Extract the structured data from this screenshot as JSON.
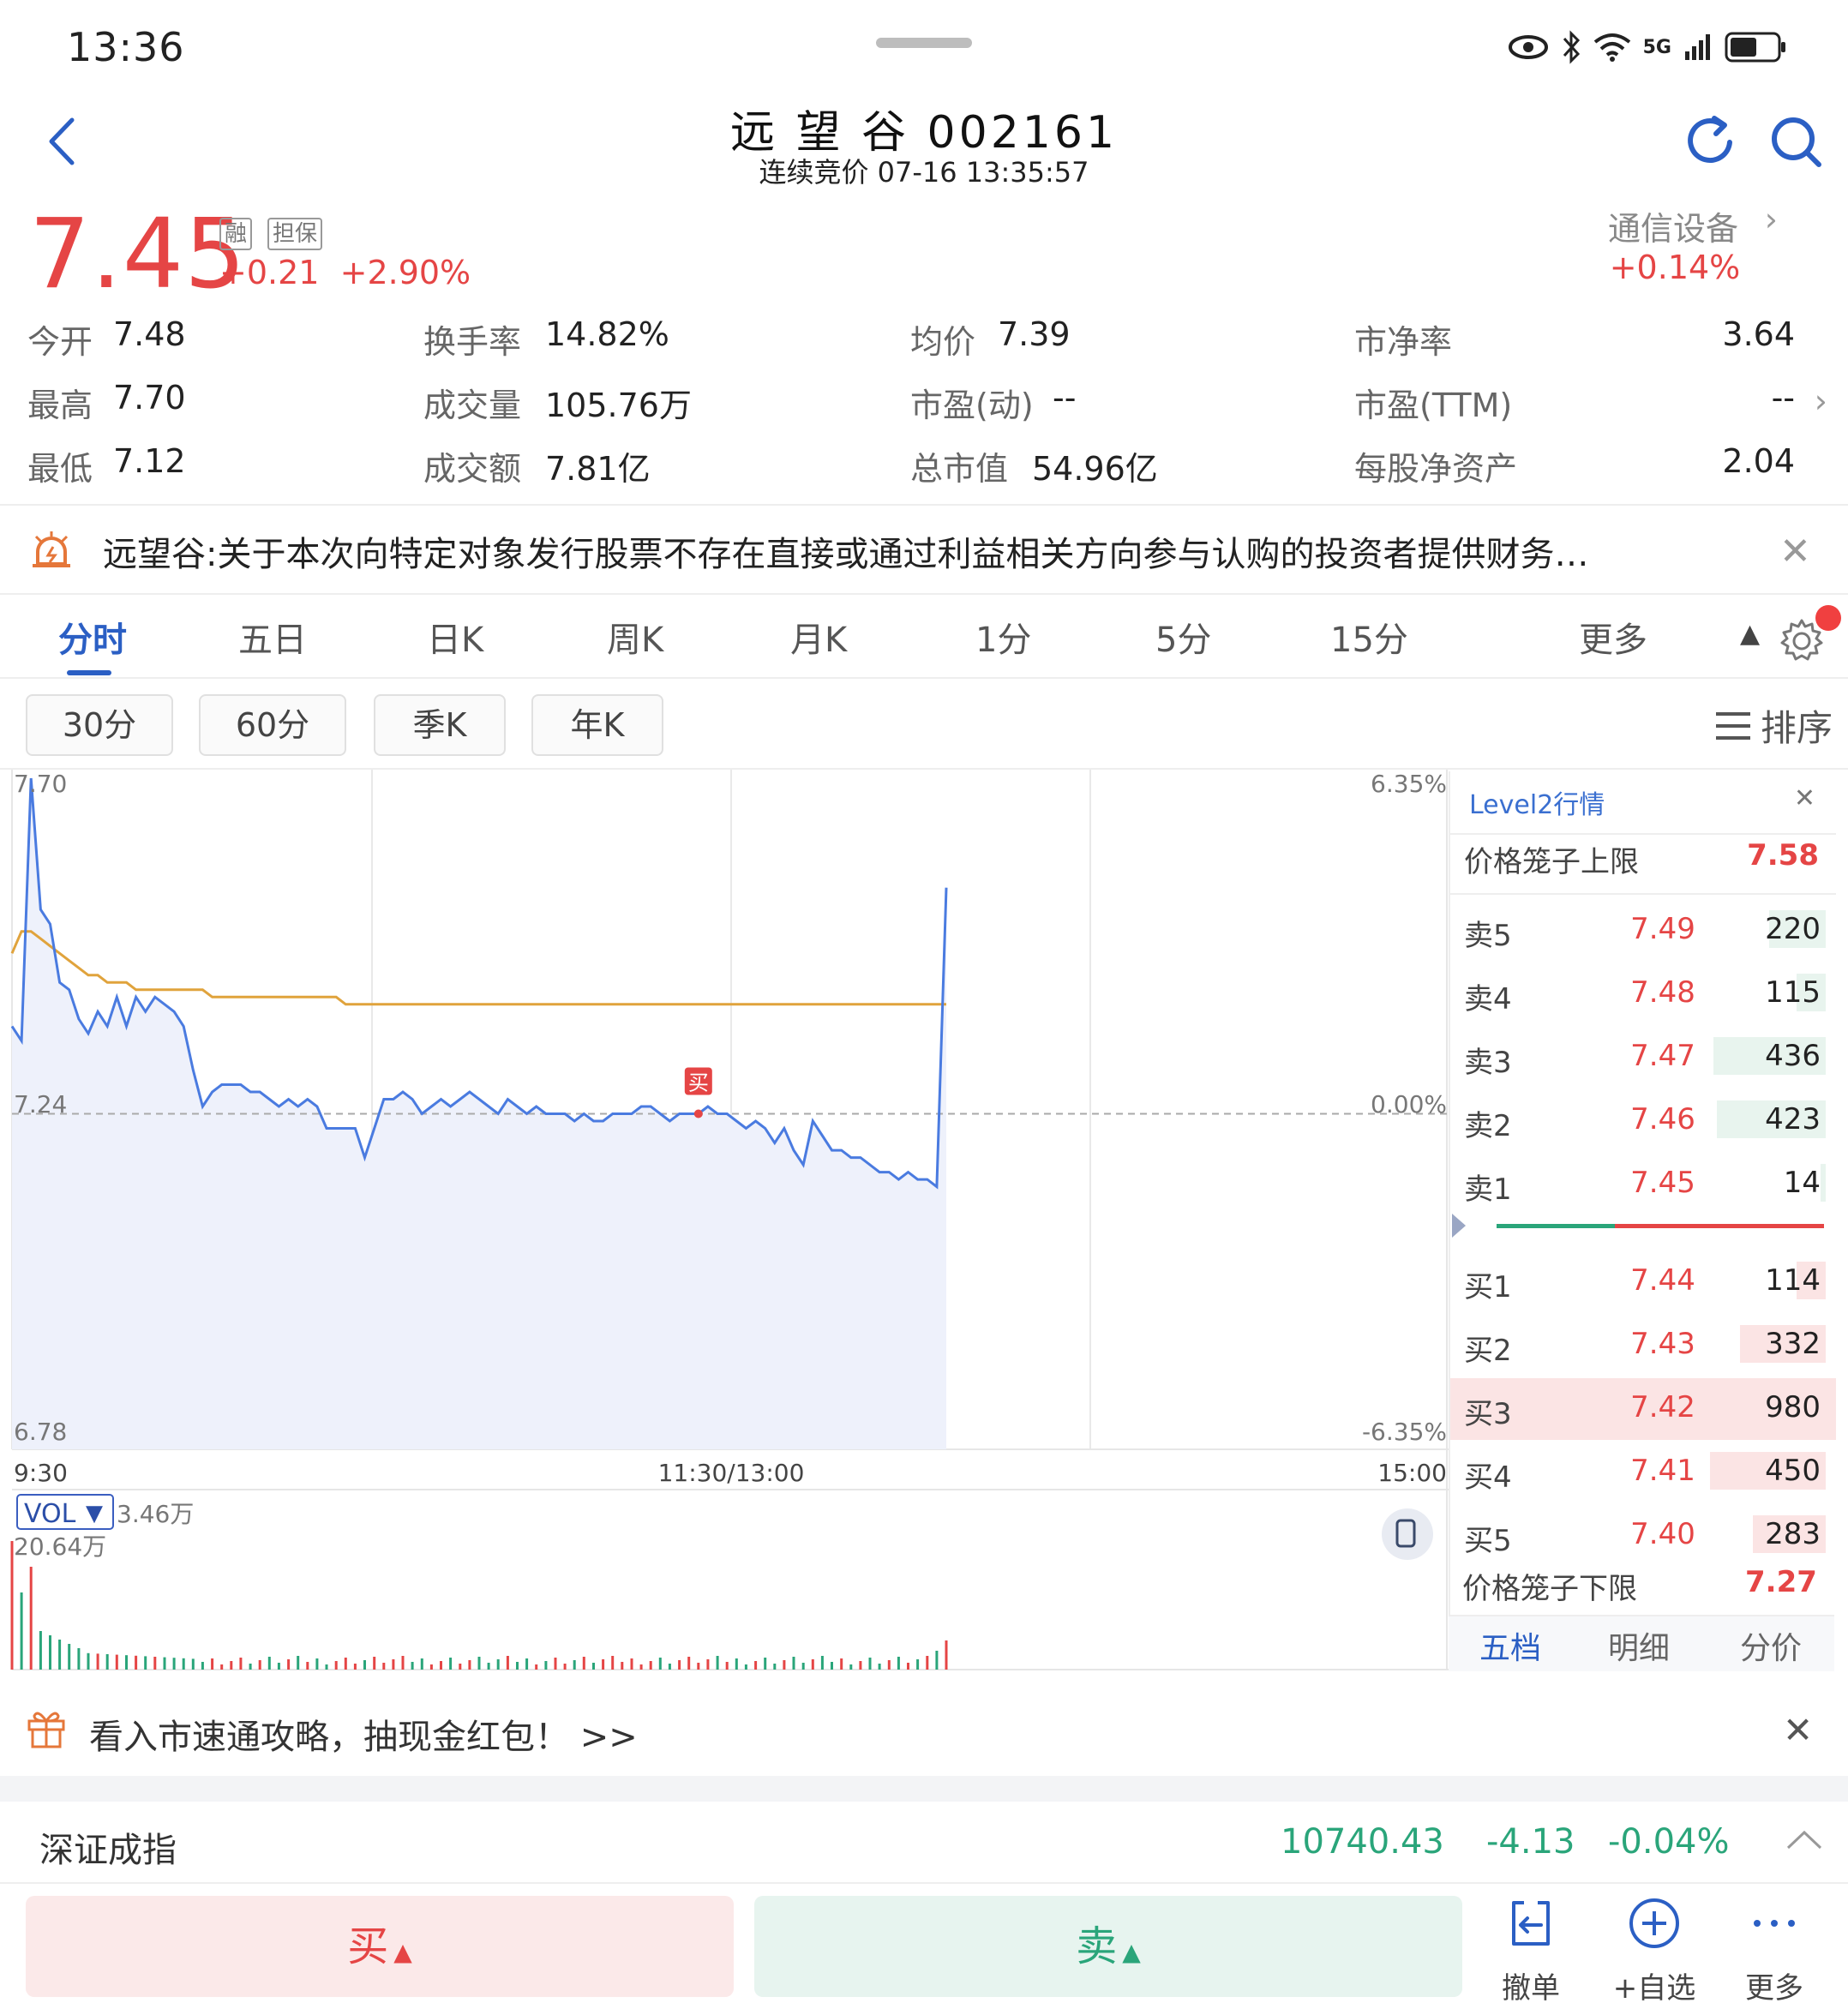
{
  "status_bar": {
    "time": "13:36",
    "network": "5G"
  },
  "header": {
    "title": "远 望 谷 002161",
    "subtitle": "连续竞价 07-16 13:35:57"
  },
  "quote": {
    "price": "7.45",
    "tag_margin": "融",
    "tag_collateral": "担保",
    "change": "+0.21  +2.90%",
    "sector_name": "通信设备",
    "sector_change": "+0.14%",
    "fields": {
      "open_label": "今开",
      "open": "7.48",
      "high_label": "最高",
      "high": "7.70",
      "low_label": "最低",
      "low": "7.12",
      "turnover_label": "换手率",
      "turnover": "14.82%",
      "volume_label": "成交量",
      "volume": "105.76万",
      "amount_label": "成交额",
      "amount": "7.81亿",
      "avg_label": "均价",
      "avg": "7.39",
      "pe_dyn_label": "市盈(动)",
      "pe_dyn": "--",
      "mktcap_label": "总市值",
      "mktcap": "54.96亿",
      "pb_label": "市净率",
      "pb": "3.64",
      "pe_ttm_label": "市盈(TTM)",
      "pe_ttm": "--",
      "bvps_label": "每股净资产",
      "bvps": "2.04"
    }
  },
  "announcement": "远望谷:关于本次向特定对象发行股票不存在直接或通过利益相关方向参与认购的投资者提供财务…",
  "period_tabs": [
    "分时",
    "五日",
    "日K",
    "周K",
    "月K",
    "1分",
    "5分",
    "15分",
    "更多"
  ],
  "period_buttons": [
    "30分",
    "60分",
    "季K",
    "年K"
  ],
  "sort_label": "排序",
  "chart_data": {
    "type": "line",
    "y_left_ticks": [
      "7.70",
      "7.24",
      "6.78"
    ],
    "y_right_ticks": [
      "6.35%",
      "0.00%",
      "-6.35%"
    ],
    "x_ticks": [
      "9:30",
      "11:30/13:00",
      "15:00"
    ],
    "prev_close": 7.24,
    "ylim": [
      6.78,
      7.7
    ],
    "price_series": [
      7.36,
      7.34,
      7.7,
      7.52,
      7.5,
      7.42,
      7.41,
      7.37,
      7.35,
      7.38,
      7.36,
      7.4,
      7.36,
      7.4,
      7.38,
      7.4,
      7.39,
      7.38,
      7.36,
      7.3,
      7.25,
      7.27,
      7.28,
      7.28,
      7.28,
      7.27,
      7.27,
      7.26,
      7.25,
      7.26,
      7.25,
      7.26,
      7.25,
      7.22,
      7.22,
      7.22,
      7.22,
      7.18,
      7.22,
      7.26,
      7.26,
      7.27,
      7.26,
      7.24,
      7.25,
      7.26,
      7.25,
      7.26,
      7.27,
      7.26,
      7.25,
      7.24,
      7.26,
      7.25,
      7.24,
      7.25,
      7.24,
      7.24,
      7.24,
      7.23,
      7.24,
      7.23,
      7.23,
      7.24,
      7.24,
      7.24,
      7.25,
      7.25,
      7.24,
      7.23,
      7.24,
      7.24,
      7.24,
      7.25,
      7.24,
      7.24,
      7.23,
      7.22,
      7.23,
      7.22,
      7.2,
      7.22,
      7.19,
      7.17,
      7.23,
      7.21,
      7.19,
      7.19,
      7.18,
      7.18,
      7.17,
      7.16,
      7.16,
      7.15,
      7.16,
      7.15,
      7.15,
      7.14,
      7.55
    ],
    "avg_series": [
      7.46,
      7.49,
      7.49,
      7.48,
      7.47,
      7.46,
      7.45,
      7.44,
      7.43,
      7.43,
      7.42,
      7.42,
      7.42,
      7.41,
      7.41,
      7.41,
      7.41,
      7.41,
      7.41,
      7.41,
      7.41,
      7.4,
      7.4,
      7.4,
      7.4,
      7.4,
      7.4,
      7.4,
      7.4,
      7.4,
      7.4,
      7.4,
      7.4,
      7.4,
      7.4,
      7.39,
      7.39,
      7.39,
      7.39,
      7.39,
      7.39,
      7.39,
      7.39,
      7.39,
      7.39,
      7.39,
      7.39,
      7.39,
      7.39,
      7.39,
      7.39,
      7.39,
      7.39,
      7.39,
      7.39,
      7.39,
      7.39,
      7.39,
      7.39,
      7.39,
      7.39,
      7.39,
      7.39,
      7.39,
      7.39,
      7.39,
      7.39,
      7.39,
      7.39,
      7.39,
      7.39,
      7.39,
      7.39,
      7.39,
      7.39,
      7.39,
      7.39,
      7.39,
      7.39,
      7.39,
      7.39,
      7.39,
      7.39,
      7.39,
      7.39,
      7.39,
      7.39,
      7.39,
      7.39,
      7.39,
      7.39,
      7.39,
      7.39,
      7.39,
      7.39,
      7.39,
      7.39,
      7.39,
      7.39
    ],
    "buy_marker_label": "买",
    "buy_marker_index": 72,
    "vol_label": "VOL",
    "vol_value": "3.46万",
    "vol_max": "20.64万"
  },
  "level2": {
    "title": "Level2行情",
    "upper_limit_label": "价格笼子上限",
    "upper_limit": "7.58",
    "lower_limit_label": "价格笼子下限",
    "lower_limit": "7.27",
    "asks": [
      {
        "label": "卖5",
        "price": "7.49",
        "vol": "220",
        "vol_num": 220
      },
      {
        "label": "卖4",
        "price": "7.48",
        "vol": "115",
        "vol_num": 115
      },
      {
        "label": "卖3",
        "price": "7.47",
        "vol": "436",
        "vol_num": 436
      },
      {
        "label": "卖2",
        "price": "7.46",
        "vol": "423",
        "vol_num": 423
      },
      {
        "label": "卖1",
        "price": "7.45",
        "vol": "14",
        "vol_num": 14
      }
    ],
    "bids": [
      {
        "label": "买1",
        "price": "7.44",
        "vol": "114",
        "vol_num": 114
      },
      {
        "label": "买2",
        "price": "7.43",
        "vol": "332",
        "vol_num": 332
      },
      {
        "label": "买3",
        "price": "7.42",
        "vol": "980",
        "vol_num": 980
      },
      {
        "label": "买4",
        "price": "7.41",
        "vol": "450",
        "vol_num": 450
      },
      {
        "label": "买5",
        "price": "7.40",
        "vol": "283",
        "vol_num": 283
      }
    ],
    "tabs": [
      "五档",
      "明细",
      "分价"
    ]
  },
  "promo": "看入市速通攻略，抽现金红包！ >>",
  "index_bar": {
    "name": "深证成指",
    "value": "10740.43",
    "change": "-4.13",
    "pct": "-0.04%"
  },
  "trade": {
    "buy_label": "买",
    "sell_label": "卖"
  },
  "bottom_actions": [
    "撤单",
    "+自选",
    "更多"
  ],
  "colors": {
    "up": "#e54545",
    "down": "#2aa57a",
    "accent": "#2b5fc4",
    "avg_line": "#e0a33c",
    "price_line": "#4a7be0"
  }
}
